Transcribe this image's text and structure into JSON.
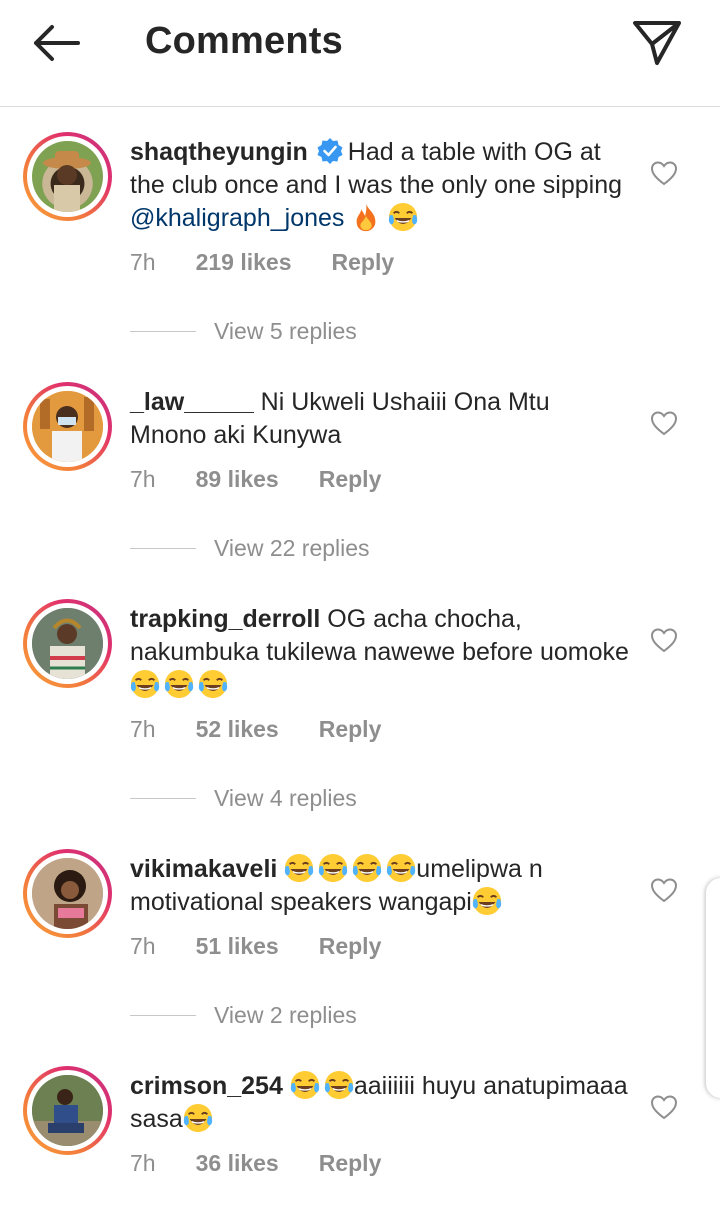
{
  "header": {
    "title": "Comments",
    "back_icon": "arrow-left-icon",
    "send_icon": "paper-plane-icon"
  },
  "comments": [
    {
      "username": "shaqtheyungin",
      "verified": true,
      "text_before": "Had a table with OG at the club once and I was the only one sipping",
      "mention": "@khaligraph_jones",
      "emojis": [
        "fire",
        "tears-of-joy"
      ],
      "time": "7h",
      "likes": "219 likes",
      "reply": "Reply",
      "view_replies": "View 5 replies"
    },
    {
      "username": "_law_____",
      "text": "Ni Ukweli Ushaiii Ona Mtu Mnono aki Kunywa",
      "time": "7h",
      "likes": "89 likes",
      "reply": "Reply",
      "view_replies": "View 22 replies"
    },
    {
      "username": "trapking_derroll",
      "text": "OG acha chocha, nakumbuka tukilewa nawewe before uomoke",
      "emojis": [
        "tears-of-joy",
        "tears-of-joy",
        "tears-of-joy"
      ],
      "time": "7h",
      "likes": "52 likes",
      "reply": "Reply",
      "view_replies": "View 4 replies"
    },
    {
      "username": "vikimakaveli",
      "text_a": "umelipwa n motivational speakers wangapi",
      "emojis": [
        "tears-of-joy",
        "tears-of-joy",
        "tears-of-joy",
        "tears-of-joy",
        "tears-of-joy"
      ],
      "time": "7h",
      "likes": "51 likes",
      "reply": "Reply",
      "view_replies": "View 2 replies"
    },
    {
      "username": "crimson_254",
      "text_a": "aaiiiiii huyu anatupimaaa sasa",
      "emojis": [
        "tears-of-joy",
        "tears-of-joy",
        "tears-of-joy"
      ],
      "time": "7h",
      "likes": "36 likes",
      "reply": "Reply"
    }
  ],
  "colors": {
    "text": "#262626",
    "meta": "#8e8e8e",
    "mention": "#00376b",
    "verified": "#3897f0",
    "divider": "#dbdbdb"
  }
}
